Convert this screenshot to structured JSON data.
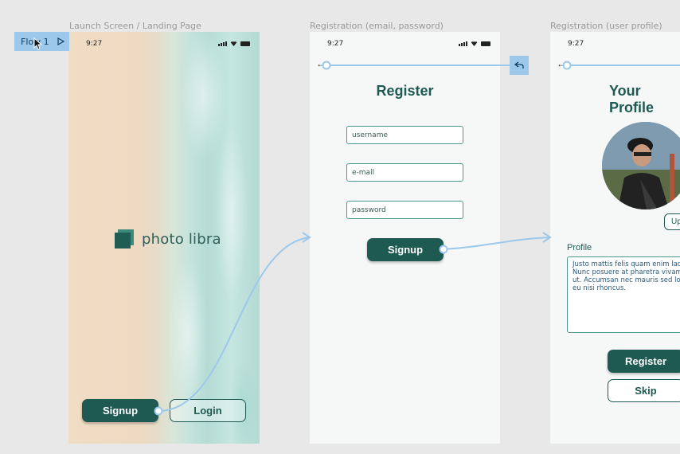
{
  "flow": {
    "label": "Flow 1"
  },
  "frames": {
    "launch": {
      "title": "Launch Screen / Landing Page",
      "time": "9:27",
      "logo_text": "photo libra",
      "signup_label": "Signup",
      "login_label": "Login"
    },
    "registration": {
      "title": "Registration (email, password)",
      "time": "9:27",
      "heading": "Register",
      "username_placeholder": "username",
      "email_placeholder": "e-mail",
      "password_placeholder": "password",
      "signup_label": "Signup"
    },
    "profile": {
      "title": "Registration (user profile)",
      "time": "9:27",
      "heading": "Your Profile",
      "upload_label": "Up",
      "profile_label": "Profile",
      "profile_lines": [
        "Justo mattis felis quam enim laoreet",
        "Nunc posuere at pharetra vivamus",
        "ut. Accumsan nec mauris sed lobortis",
        "eu nisi rhoncus."
      ],
      "register_label": "Register",
      "skip_label": "Skip"
    }
  },
  "colors": {
    "canvas": "#e8e8e8",
    "brand": "#1e5a52",
    "prototype_link": "#9cc8ec"
  },
  "icons": [
    "cursor-icon",
    "play-icon",
    "back-arrow-icon",
    "signal-icon",
    "wifi-icon",
    "battery-icon",
    "return-icon"
  ]
}
